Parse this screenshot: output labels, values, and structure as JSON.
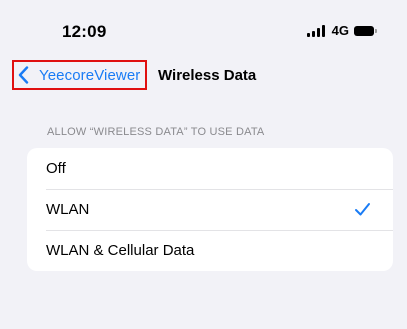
{
  "status_bar": {
    "time": "12:09",
    "network": "4G",
    "icons": [
      "signal-bars-icon",
      "battery-icon"
    ]
  },
  "nav": {
    "back_label": "YeecoreViewer",
    "back_icon": "chevron-left-icon",
    "title": "Wireless Data"
  },
  "section": {
    "header": "ALLOW “WIRELESS DATA” TO USE DATA",
    "options": [
      {
        "label": "Off",
        "selected": false
      },
      {
        "label": "WLAN",
        "selected": true
      },
      {
        "label": "WLAN & Cellular Data",
        "selected": false
      }
    ],
    "selected_icon": "checkmark-icon"
  },
  "colors": {
    "accent": "#1a7cf5",
    "background": "#f2f2f7",
    "highlight_box": "#e01010"
  }
}
